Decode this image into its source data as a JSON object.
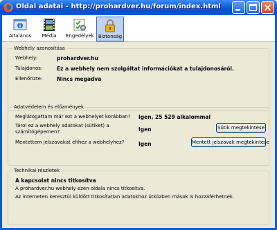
{
  "window": {
    "title": "Oldal adatai - http://prohardver.hu/forum/index.html"
  },
  "toolbar": {
    "tabs": [
      {
        "label": "Általános",
        "icon": "info-icon"
      },
      {
        "label": "Média",
        "icon": "media-icon"
      },
      {
        "label": "Engedélyek",
        "icon": "permissions-icon"
      },
      {
        "label": "Biztonság",
        "icon": "lock-icon"
      }
    ],
    "active": "Biztonság"
  },
  "identity": {
    "title": "Webhely azonosítása",
    "rows": [
      {
        "label": "Webhely:",
        "value": "prohardver.hu"
      },
      {
        "label": "Tulajdonos:",
        "value": "Ez a webhely nem szolgáltat információkat a tulajdonosáról."
      },
      {
        "label": "Ellenőrizte:",
        "value": "Nincs megadva"
      }
    ]
  },
  "privacy": {
    "title": "Adatvédelem és előzmények",
    "q1": "Meglátogattam már ezt a webhelyet korábban?",
    "a1": "Igen, 25 529 alkalommal",
    "q2_line1": "Tárol ez a webhely adatokat (sütiket) a",
    "q2_line2": "számítógépemen?",
    "a2": "Igen",
    "cookies_button": "Sütik megtekintése",
    "q3": "Mentettem jelszavakat ehhez a webhelyhez?",
    "a3": "Igen",
    "passwords_button": "Mentett jelszavak megtekintése"
  },
  "technical": {
    "title": "Technikai részletek",
    "heading": "A kapcsolat nincs titkosítva",
    "line1": "A prohardver.hu webhely ezen oldala nincs titkosítva.",
    "line2": "Az interneten keresztül küldött titkosítatlan adatokhoz útközben mások is hozzáférhetnek."
  },
  "colors": {
    "titlebar": "#0b5fe0",
    "face": "#ece9d8",
    "active_tab": "#c1d2ee"
  }
}
